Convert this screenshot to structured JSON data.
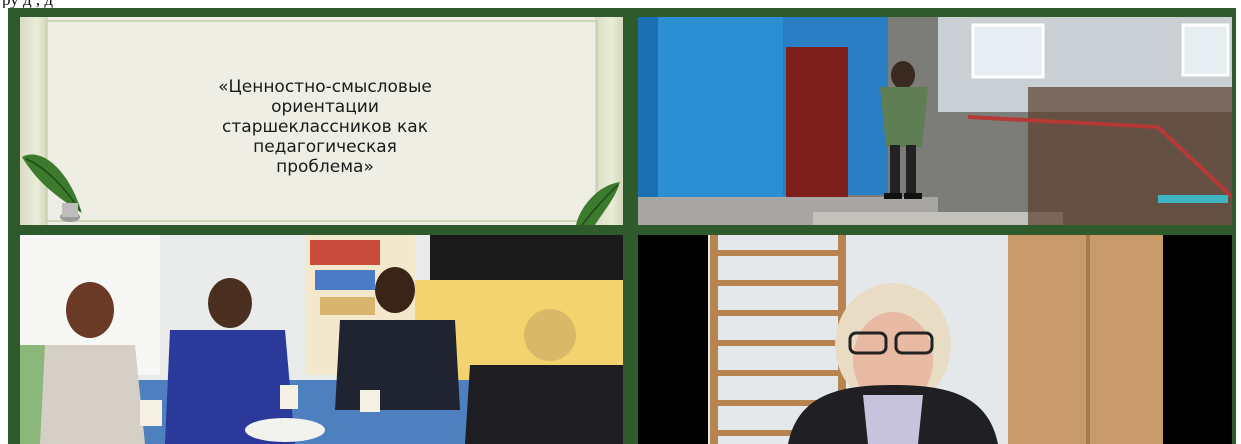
{
  "top_caption": "ру          д             ,         д",
  "slide": {
    "title": "«Ценностно-смысловые\nориентации\nстаршеклассников как\nпедагогическая\nпроблема»"
  },
  "colors": {
    "frame_green": "#2e5a2c",
    "slide_bg": "#eeeee4",
    "leaf_green": "#3c7a2e"
  },
  "icons": [
    "feather-quill-icon",
    "inkwell-icon",
    "feather-leaf-icon"
  ]
}
